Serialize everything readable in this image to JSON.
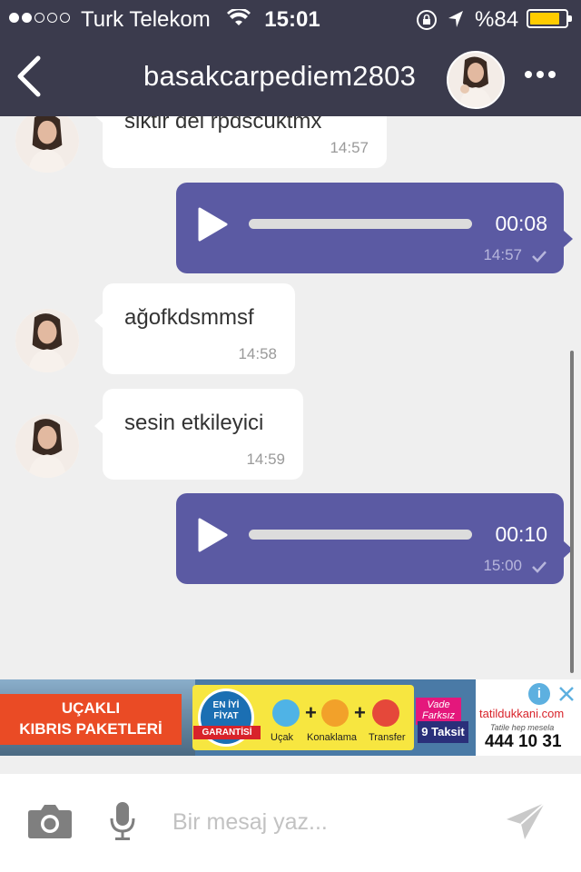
{
  "status_bar": {
    "carrier": "Turk Telekom",
    "time": "15:01",
    "battery_pct": "%84",
    "battery_level": 0.84,
    "icons": [
      "signal-dots-icon",
      "wifi-icon",
      "rotation-lock-icon",
      "location-arrow-icon",
      "battery-icon"
    ]
  },
  "header": {
    "title": "basakcarpediem2803",
    "icons": [
      "back-chevron-icon",
      "avatar",
      "more-dots-icon"
    ]
  },
  "messages": [
    {
      "direction": "in",
      "text": "siktir del rpdscuktmx",
      "time": "14:57",
      "partial": true
    },
    {
      "direction": "out",
      "type": "voice",
      "duration": "00:08",
      "time": "14:57",
      "status": "sent-check-icon"
    },
    {
      "direction": "in",
      "text": "ağofkdsmmsf",
      "time": "14:58"
    },
    {
      "direction": "in",
      "text": "sesin etkileyici",
      "time": "14:59"
    },
    {
      "direction": "out",
      "type": "voice",
      "duration": "00:10",
      "time": "15:00",
      "status": "sent-check-icon"
    }
  ],
  "ad": {
    "left_line1": "UÇAKLI",
    "left_line2": "KIBRIS PAKETLERİ",
    "badge_line1": "EN İYİ",
    "badge_line2": "FİYAT",
    "badge_line3": "GARANTİSİ",
    "item1": "Uçak",
    "item2": "Konaklama",
    "item3": "Transfer",
    "plus": "+",
    "promo1": "Vade Farksız",
    "promo2": "9 Taksit",
    "brand": "tatildukkani.com",
    "slogan": "Tatile hep mesela",
    "phone": "444 10 31",
    "info": "i"
  },
  "composer": {
    "placeholder": "Bir mesaj yaz...",
    "value": "",
    "icons": [
      "camera-icon",
      "microphone-icon",
      "send-icon"
    ]
  },
  "colors": {
    "header_bg": "#3b3b4d",
    "outgoing_bubble": "#5b5aa3",
    "chat_bg": "#efefef",
    "battery": "#ffcc00"
  }
}
